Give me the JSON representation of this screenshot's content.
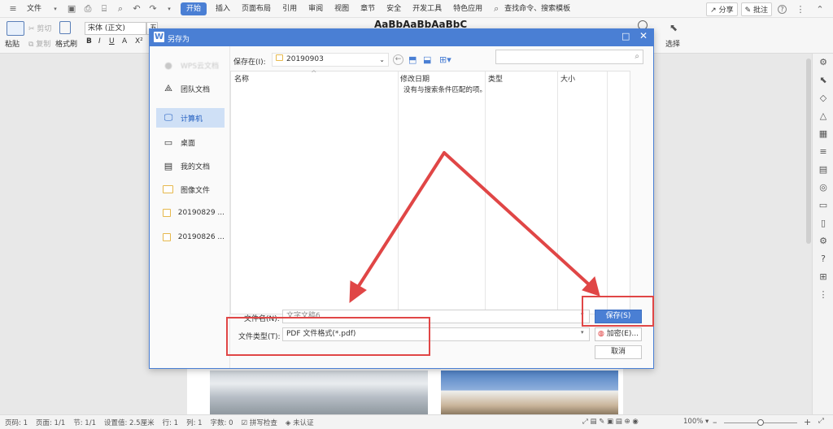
{
  "menubar": {
    "file": "文件",
    "tabs": [
      "开始",
      "插入",
      "页面布局",
      "引用",
      "审阅",
      "视图",
      "章节",
      "安全",
      "开发工具",
      "特色应用"
    ],
    "search": "查找命令、搜索模板",
    "share": "分享",
    "comment": "批注",
    "help": "?"
  },
  "ribbon": {
    "paste": "粘贴",
    "cut": "剪切",
    "copy": "复制",
    "format_painter": "格式刷",
    "font_name": "宋体 (正文)",
    "font_size": "五号",
    "styles_preview": "AaBbAaBbAaBbC",
    "select": "选择"
  },
  "dialog": {
    "title": "另存为",
    "save_in_label": "保存在(I):",
    "save_in_value": "20190903",
    "search_placeholder": "",
    "nav": {
      "cloud": "WPS云文档",
      "team": "团队文档",
      "computer": "计算机",
      "desktop": "桌面",
      "mydocs": "我的文档",
      "pictures": "图像文件",
      "folder1": "20190829 ...",
      "folder2": "20190826 ..."
    },
    "columns": [
      "名称",
      "修改日期",
      "类型",
      "大小"
    ],
    "empty_message": "没有与搜索条件匹配的项。",
    "filename_label": "文件名(N):",
    "filename_value": "文字文稿6",
    "filetype_label": "文件类型(T):",
    "filetype_value": "PDF 文件格式(*.pdf)",
    "save_button": "保存(S)",
    "encrypt_button": "加密(E)...",
    "cancel_button": "取消"
  },
  "statusbar": {
    "page_code": "页码: 1",
    "pages": "页面: 1/1",
    "section": "节: 1/1",
    "setting": "设置值: 2.5厘米",
    "row": "行: 1",
    "col": "列: 1",
    "words": "字数: 0",
    "spell": "拼写检查",
    "cert": "未认证",
    "zoom": "100%"
  },
  "colors": {
    "accent": "#4a7fd4",
    "annotation": "#e04646"
  }
}
